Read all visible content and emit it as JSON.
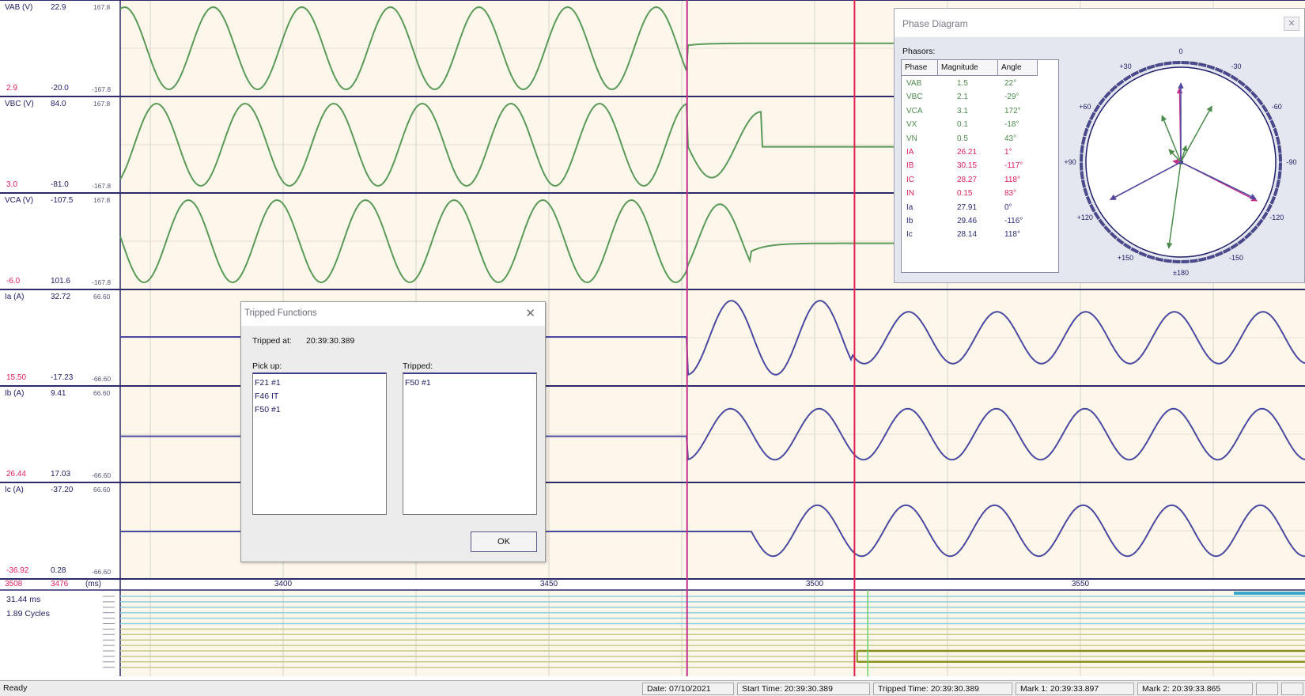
{
  "channels": [
    {
      "name": "VAB (V)",
      "value": "22.9",
      "scale_top": "167.8",
      "scale_bottom": "-167.8",
      "mark_a": "2.9",
      "mark_b": "-20.0",
      "color": "#5a9a5a"
    },
    {
      "name": "VBC (V)",
      "value": "84.0",
      "scale_top": "167.8",
      "scale_bottom": "-167.8",
      "mark_a": "3.0",
      "mark_b": "-81.0",
      "color": "#5a9a5a"
    },
    {
      "name": "VCA (V)",
      "value": "-107.5",
      "scale_top": "167.8",
      "scale_bottom": "-167.8",
      "mark_a": "-6.0",
      "mark_b": "101.6",
      "color": "#5a9a5a"
    },
    {
      "name": "Ia (A)",
      "value": "32.72",
      "scale_top": "66.60",
      "scale_bottom": "-66.60",
      "mark_a": "15.50",
      "mark_b": "-17.23",
      "color": "#4a4aa0"
    },
    {
      "name": "Ib (A)",
      "value": "9.41",
      "scale_top": "66.60",
      "scale_bottom": "-66.60",
      "mark_a": "26.44",
      "mark_b": "17.03",
      "color": "#4a4aa0"
    },
    {
      "name": "Ic (A)",
      "value": "-37.20",
      "scale_top": "66.60",
      "scale_bottom": "-66.60",
      "mark_a": "-36.92",
      "mark_b": "0.28",
      "color": "#4a4aa0"
    }
  ],
  "time_axis": {
    "left_a": "3508",
    "left_b": "3476",
    "unit": "(ms)",
    "ticks": [
      {
        "label": "3400",
        "value": 3400
      },
      {
        "label": "3450",
        "value": 3450
      },
      {
        "label": "3500",
        "value": 3500
      },
      {
        "label": "3550",
        "value": 3550
      }
    ]
  },
  "digital_panel": {
    "delta_time": "31.44 ms",
    "delta_cycles": "1.89 Cycles"
  },
  "tripped_dialog": {
    "title": "Tripped Functions",
    "close_glyph": "✕",
    "tripped_at_label": "Tripped at:",
    "tripped_at_value": "20:39:30.389",
    "pickup_label": "Pick up:",
    "pickup_items": [
      "F21 #1",
      "F46 IT",
      "F50 #1"
    ],
    "tripped_label": "Tripped:",
    "tripped_items": [
      "F50 #1"
    ],
    "ok_label": "OK"
  },
  "phase_diagram": {
    "title": "Phase Diagram",
    "close_glyph": "✕",
    "phasors_label": "Phasors:",
    "columns": [
      "Phase",
      "Magnitude",
      "Angle"
    ],
    "rows": [
      {
        "phase": "VAB",
        "magnitude": "1.5",
        "angle": "22°",
        "color": "#4a8a4a"
      },
      {
        "phase": "VBC",
        "magnitude": "2.1",
        "angle": "-29°",
        "color": "#4a8a4a"
      },
      {
        "phase": "VCA",
        "magnitude": "3.1",
        "angle": "172°",
        "color": "#4a8a4a"
      },
      {
        "phase": "VX",
        "magnitude": "0.1",
        "angle": "-18°",
        "color": "#4a8a4a"
      },
      {
        "phase": "VN",
        "magnitude": "0.5",
        "angle": "43°",
        "color": "#4a8a4a"
      },
      {
        "phase": "IA",
        "magnitude": "26.21",
        "angle": "1°",
        "color": "#e0205a"
      },
      {
        "phase": "IB",
        "magnitude": "30.15",
        "angle": "-117°",
        "color": "#e0205a"
      },
      {
        "phase": "IC",
        "magnitude": "28.27",
        "angle": "118°",
        "color": "#e0205a"
      },
      {
        "phase": "IN",
        "magnitude": "0.15",
        "angle": "83°",
        "color": "#e0205a"
      },
      {
        "phase": "Ia",
        "magnitude": "27.91",
        "angle": "0°",
        "color": "#2a2a7a"
      },
      {
        "phase": "Ib",
        "magnitude": "29.46",
        "angle": "-116°",
        "color": "#2a2a7a"
      },
      {
        "phase": "Ic",
        "magnitude": "28.14",
        "angle": "118°",
        "color": "#2a2a7a"
      }
    ],
    "dial_labels": [
      {
        "text": "0",
        "deg": 0
      },
      {
        "text": "-30",
        "deg": -30
      },
      {
        "text": "-60",
        "deg": -60
      },
      {
        "text": "-90",
        "deg": -90
      },
      {
        "text": "-120",
        "deg": -120
      },
      {
        "text": "-150",
        "deg": -150
      },
      {
        "text": "±180",
        "deg": 180
      },
      {
        "text": "+150",
        "deg": 150
      },
      {
        "text": "+120",
        "deg": 120
      },
      {
        "text": "+90",
        "deg": 90
      },
      {
        "text": "+60",
        "deg": 60
      },
      {
        "text": "+30",
        "deg": 30
      }
    ]
  },
  "status_bar": {
    "ready": "Ready",
    "date": "Date: 07/10/2021",
    "start_time": "Start Time: 20:39:30.389",
    "tripped_time": "Tripped Time: 20:39:30.389",
    "mark1": "Mark 1: 20:39:33.897",
    "mark2": "Mark 2: 20:39:33.865"
  },
  "colors": {
    "plot_bg": "#fdf6ea",
    "voltage_trace": "#5a9a5a",
    "current_trace": "#4a4aa0",
    "mark_line_1": "#c0308a",
    "mark_line_2": "#e02050",
    "separator": "#2a2a6a"
  }
}
